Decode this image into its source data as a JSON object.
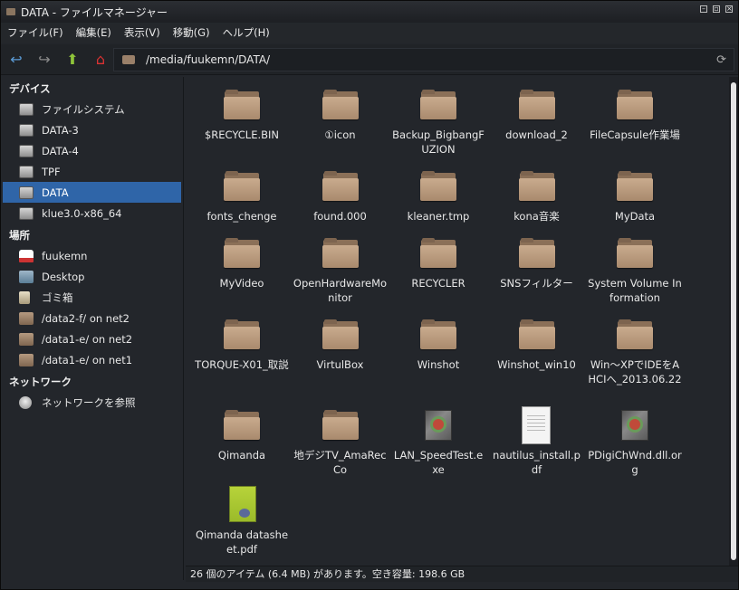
{
  "window": {
    "title": "DATA - ファイルマネージャー"
  },
  "menu": [
    "ファイル(F)",
    "編集(E)",
    "表示(V)",
    "移動(G)",
    "ヘルプ(H)"
  ],
  "toolbar": {
    "path": "/media/fuukemn/DATA/"
  },
  "sidebar": {
    "devices_header": "デバイス",
    "devices": [
      "ファイルシステム",
      "DATA-3",
      "DATA-4",
      "TPF",
      "DATA",
      "klue3.0-x86_64"
    ],
    "places_header": "場所",
    "places": [
      "fuukemn",
      "Desktop",
      "ゴミ箱",
      "/data2-f/ on net2",
      "/data1-e/ on net2",
      "/data1-e/ on net1"
    ],
    "network_header": "ネットワーク",
    "network": [
      "ネットワークを参照"
    ]
  },
  "files": [
    {
      "name": "$RECYCLE.BIN",
      "type": "folder"
    },
    {
      "name": "①icon",
      "type": "folder"
    },
    {
      "name": "Backup_BigbangFUZION",
      "type": "folder"
    },
    {
      "name": "download_2",
      "type": "folder"
    },
    {
      "name": "FileCapsule作業場",
      "type": "folder"
    },
    {
      "name": "fonts_chenge",
      "type": "folder"
    },
    {
      "name": "found.000",
      "type": "folder"
    },
    {
      "name": "kleaner.tmp",
      "type": "folder"
    },
    {
      "name": "kona音楽",
      "type": "folder"
    },
    {
      "name": "MyData",
      "type": "folder"
    },
    {
      "name": "MyVideo",
      "type": "folder"
    },
    {
      "name": "OpenHardwareMonitor",
      "type": "folder"
    },
    {
      "name": "RECYCLER",
      "type": "folder"
    },
    {
      "name": "SNSフィルター",
      "type": "folder"
    },
    {
      "name": "System Volume Information",
      "type": "folder"
    },
    {
      "name": "TORQUE-X01_取説",
      "type": "folder"
    },
    {
      "name": "VirtulBox",
      "type": "folder"
    },
    {
      "name": "Winshot",
      "type": "folder"
    },
    {
      "name": "Winshot_win10",
      "type": "folder"
    },
    {
      "name": "Win～XPでIDEをAHCIへ_2013.06.22",
      "type": "folder"
    },
    {
      "name": "Qimanda",
      "type": "folder"
    },
    {
      "name": "地デジTV_AmaRecCo",
      "type": "folder"
    },
    {
      "name": "LAN_SpeedTest.exe",
      "type": "exe"
    },
    {
      "name": "nautilus_install.pdf",
      "type": "pdf"
    },
    {
      "name": "PDigiChWnd.dll.org",
      "type": "exe"
    },
    {
      "name": "Qimanda datasheet.pdf",
      "type": "greenpdf"
    }
  ],
  "status": "26 個のアイテム (6.4 MB) があります。空き容量: 198.6 GB"
}
